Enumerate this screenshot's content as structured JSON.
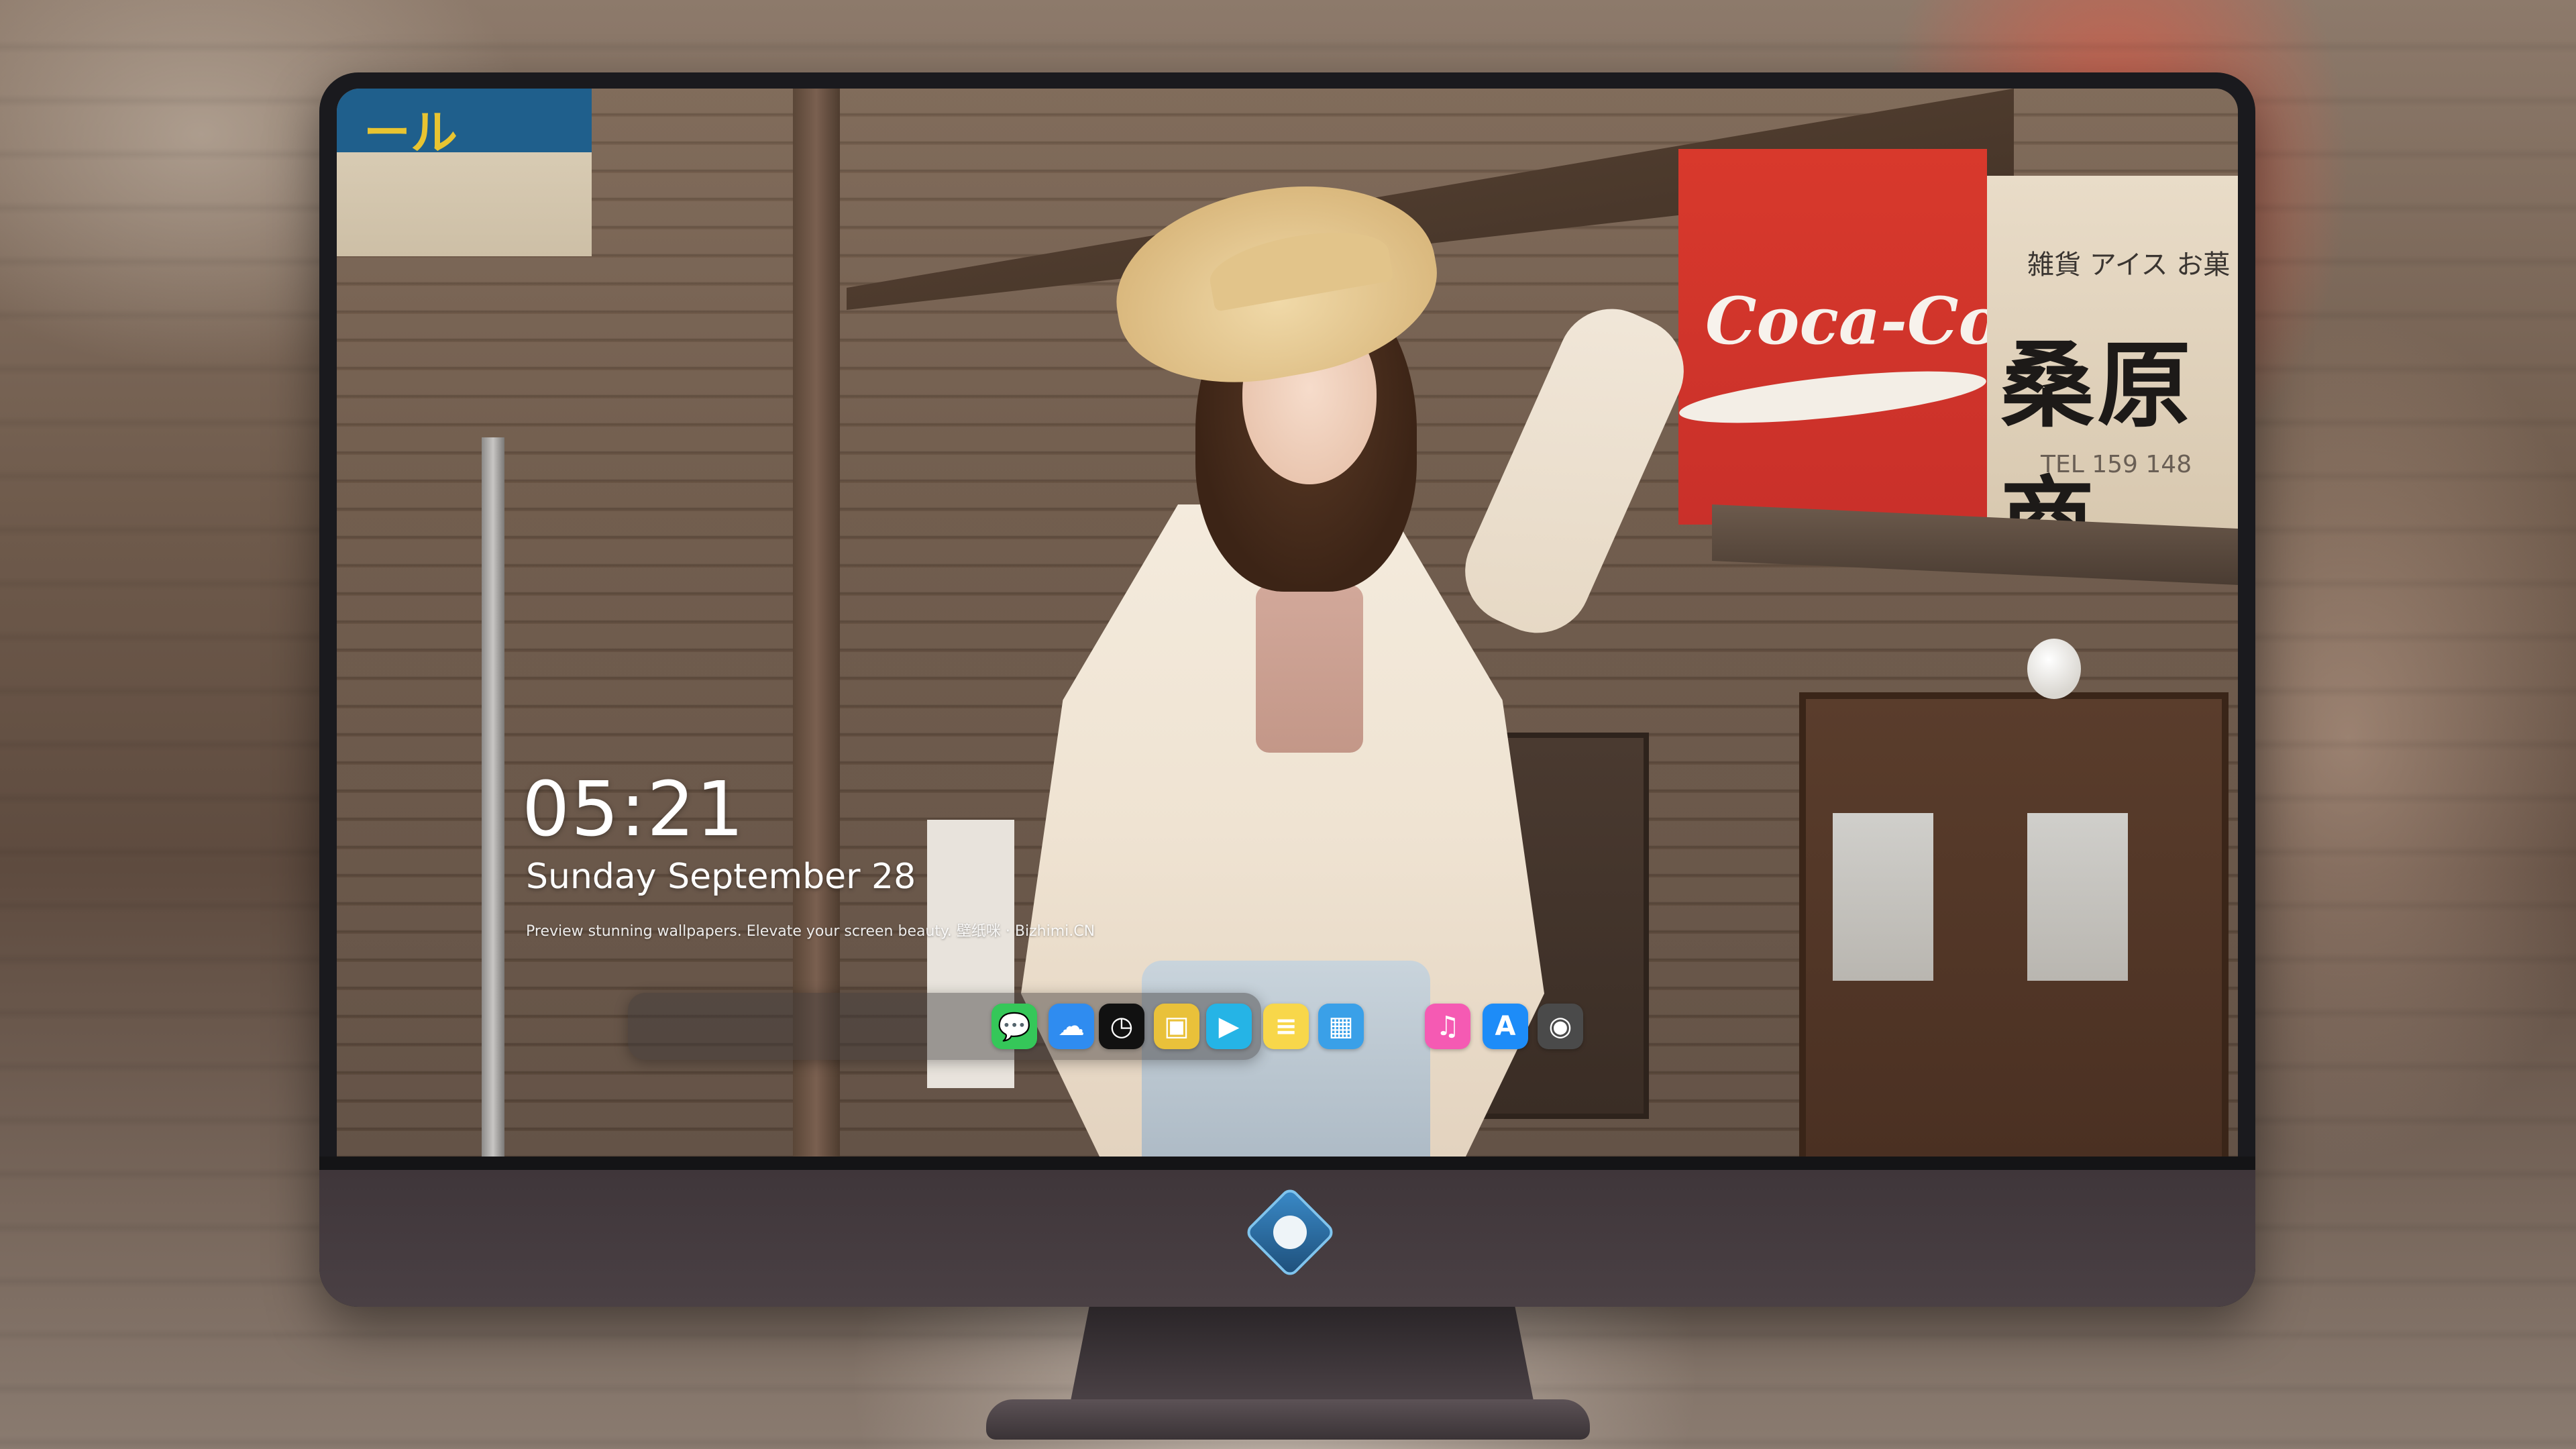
{
  "lockscreen": {
    "time": "05:21",
    "date": "Sunday September   28",
    "tagline": "Preview stunning wallpapers. Elevate your screen beauty. 壁纸咪 · Bizhimi.CN"
  },
  "wallpaper": {
    "left_sign_text": "ール",
    "coke_text": "Coca-Cola",
    "store_sign_main": "桑原商",
    "store_sign_small": "雑貨 アイス お菓",
    "store_sign_tel": "TEL 159 148"
  },
  "dock": {
    "apps": [
      {
        "name": "messages-icon",
        "label": "Messages",
        "color": "#35c759"
      },
      {
        "name": "weather-icon",
        "label": "Weather",
        "color": "#2f8cf0"
      },
      {
        "name": "clock-icon",
        "label": "Clock",
        "color": "#111111"
      },
      {
        "name": "preview-icon",
        "label": "Preview",
        "color": "#e9c13a"
      },
      {
        "name": "clips-icon",
        "label": "Clips",
        "color": "#25b4e6"
      },
      {
        "name": "notes-icon",
        "label": "Notes",
        "color": "#f8d74a"
      },
      {
        "name": "photo-booth-icon",
        "label": "Photo Booth",
        "color": "#3aa0e8"
      },
      {
        "name": "music-icon",
        "label": "Music",
        "color": "#f55ab3"
      },
      {
        "name": "app-store-icon",
        "label": "App Store",
        "color": "#1d8cf8"
      },
      {
        "name": "camera-icon",
        "label": "Camera",
        "color": "#4a4a4a"
      }
    ]
  }
}
